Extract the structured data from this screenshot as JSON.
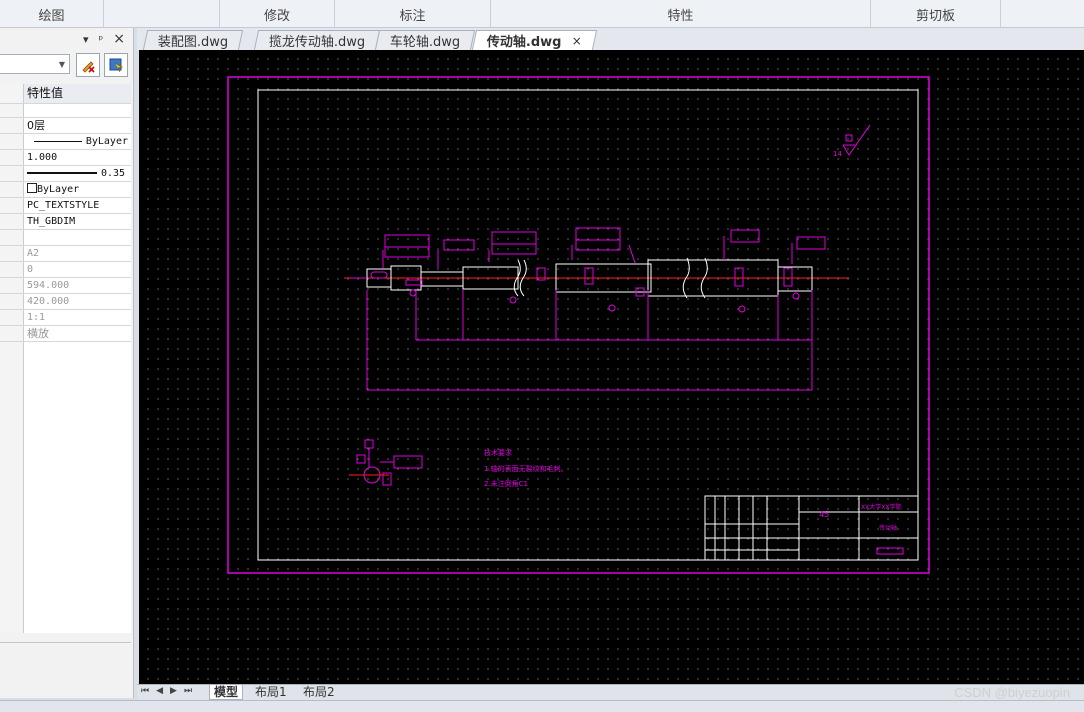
{
  "ribbon": {
    "groups": [
      "绘图",
      "修改",
      "标注",
      "特性",
      "剪切板"
    ]
  },
  "props_panel": {
    "pin": "▾",
    "pin2": "ᵖ",
    "close": "×",
    "header_value": "特性值",
    "rows": [
      "0层",
      "ByLayer",
      "1.000",
      "0.35 mm",
      "ByLayer",
      "PC_TEXTSTYLE",
      "TH_GBDIM"
    ],
    "rows_dim": [
      "A2",
      "0",
      "594.000",
      "420.000",
      "1:1",
      "横放"
    ]
  },
  "file_tabs": [
    "装配图.dwg",
    "揽龙传动轴.dwg",
    "车轮轴.dwg",
    "传动轴.dwg"
  ],
  "file_tab_close": "×",
  "drawing": {
    "notes_title": "技术要求",
    "notes_line1": "1.轴的表面无裂纹和毛刺。",
    "notes_line2": "2.未注倒角C1",
    "material": "45",
    "title_company": "XX大学XX学院",
    "title_part": "传动轴",
    "roughness_label": "14"
  },
  "layout_tabs": [
    "模型",
    "布局1",
    "布局2"
  ],
  "watermark": "CSDN @biyezuopin",
  "colors": {
    "magenta": "#e000e0",
    "white": "#ffffff",
    "red": "#ff2020",
    "background": "#000000"
  }
}
